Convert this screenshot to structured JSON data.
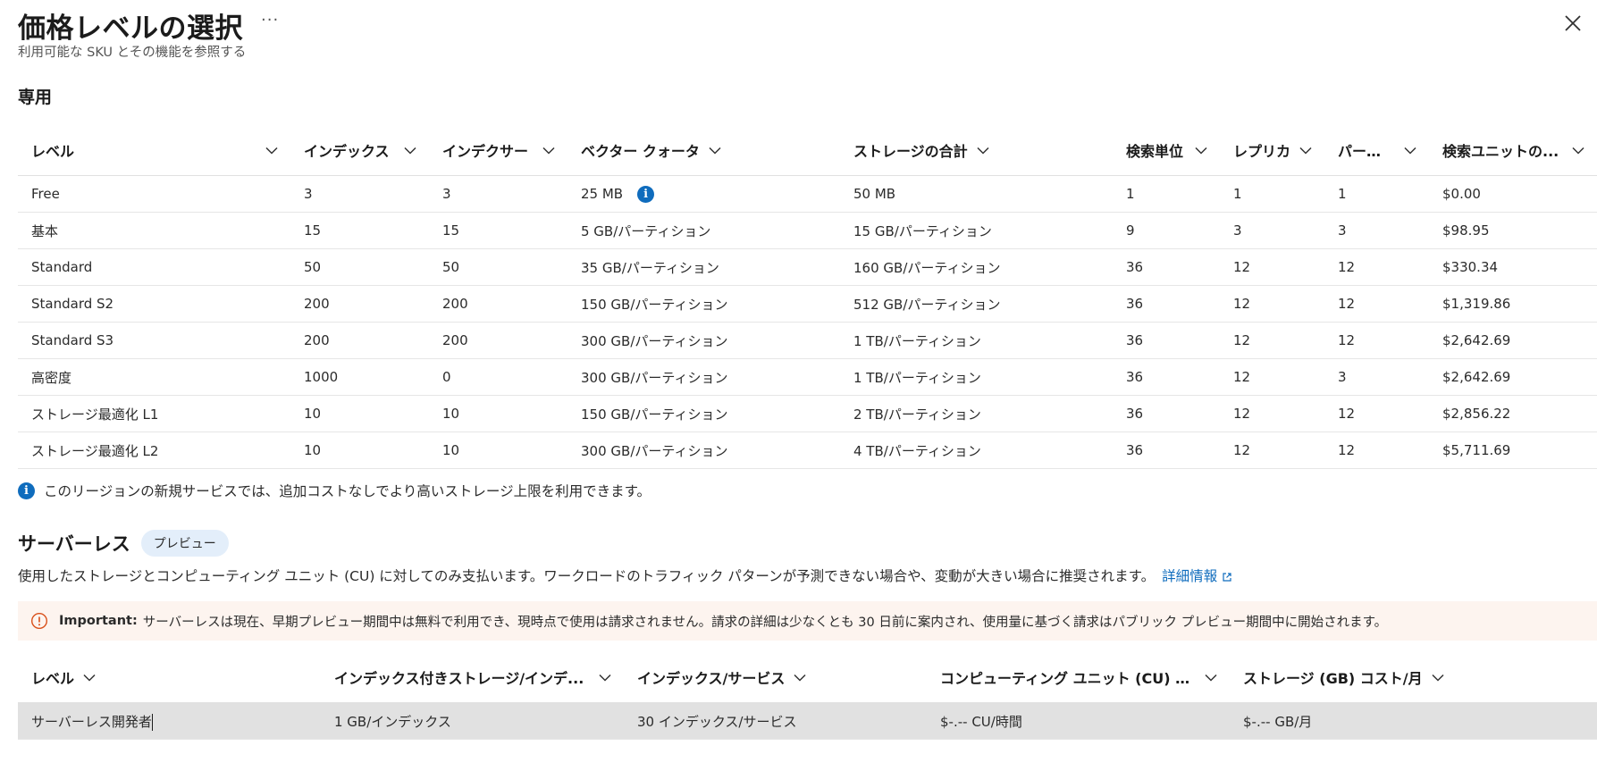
{
  "header": {
    "title": "価格レベルの選択",
    "more_label": "···",
    "subtitle": "利用可能な SKU とその機能を参照する"
  },
  "dedicated": {
    "section_title": "専用",
    "columns": [
      "レベル",
      "インデックス",
      "インデクサー",
      "ベクター クォータ",
      "ストレージの合計",
      "検索単位",
      "レプリカ",
      "パーテ...",
      "検索ユニットの..."
    ],
    "rows": [
      {
        "level": "Free",
        "indexes": "3",
        "indexers": "3",
        "vector": "25 MB",
        "storage": "50 MB",
        "units": "1",
        "replicas": "1",
        "partitions": "1",
        "cost": "$0.00"
      },
      {
        "level": "基本",
        "indexes": "15",
        "indexers": "15",
        "vector": "5 GB/パーティション",
        "storage": "15 GB/パーティション",
        "units": "9",
        "replicas": "3",
        "partitions": "3",
        "cost": "$98.95"
      },
      {
        "level": "Standard",
        "indexes": "50",
        "indexers": "50",
        "vector": "35 GB/パーティション",
        "storage": "160 GB/パーティション",
        "units": "36",
        "replicas": "12",
        "partitions": "12",
        "cost": "$330.34"
      },
      {
        "level": "Standard S2",
        "indexes": "200",
        "indexers": "200",
        "vector": "150 GB/パーティション",
        "storage": "512 GB/パーティション",
        "units": "36",
        "replicas": "12",
        "partitions": "12",
        "cost": "$1,319.86"
      },
      {
        "level": "Standard S3",
        "indexes": "200",
        "indexers": "200",
        "vector": "300 GB/パーティション",
        "storage": "1 TB/パーティション",
        "units": "36",
        "replicas": "12",
        "partitions": "12",
        "cost": "$2,642.69"
      },
      {
        "level": "高密度",
        "indexes": "1000",
        "indexers": "0",
        "vector": "300 GB/パーティション",
        "storage": "1 TB/パーティション",
        "units": "36",
        "replicas": "12",
        "partitions": "3",
        "cost": "$2,642.69"
      },
      {
        "level": "ストレージ最適化 L1",
        "indexes": "10",
        "indexers": "10",
        "vector": "150 GB/パーティション",
        "storage": "2 TB/パーティション",
        "units": "36",
        "replicas": "12",
        "partitions": "12",
        "cost": "$2,856.22"
      },
      {
        "level": "ストレージ最適化 L2",
        "indexes": "10",
        "indexers": "10",
        "vector": "300 GB/パーティション",
        "storage": "4 TB/パーティション",
        "units": "36",
        "replicas": "12",
        "partitions": "12",
        "cost": "$5,711.69"
      }
    ],
    "note": "このリージョンの新規サービスでは、追加コストなしでより高いストレージ上限を利用できます。"
  },
  "serverless": {
    "section_title": "サーバーレス",
    "badge": "プレビュー",
    "description": "使用したストレージとコンピューティング ユニット (CU) に対してのみ支払います。ワークロードのトラフィック パターンが予測できない場合や、変動が大きい場合に推奨されます。",
    "learn_more": "詳細情報",
    "warning_label": "Important:",
    "warning_text": "サーバーレスは現在、早期プレビュー期間中は無料で利用でき、現時点で使用は請求されません。請求の詳細は少なくとも 30 日前に案内され、使用量に基づく請求はパブリック プレビュー期間中に開始されます。",
    "columns": [
      "レベル",
      "インデックス付きストレージ/インデ...",
      "インデックス/サービス",
      "コンピューティング ユニット (CU) コ...",
      "ストレージ (GB) コスト/月"
    ],
    "rows": [
      {
        "level": "サーバーレス開発者",
        "storage": "1 GB/インデックス",
        "indexes": "30 インデックス/サービス",
        "cu_cost": "$-.-- CU/時間",
        "storage_cost": "$-.-- GB/月"
      }
    ]
  },
  "colors": {
    "accent": "#0f6cbd",
    "warning_bg": "#fdf4ef",
    "warning_icon": "#d9501a",
    "selected_row": "#e1e1e1",
    "badge_bg": "#e3eefa"
  }
}
